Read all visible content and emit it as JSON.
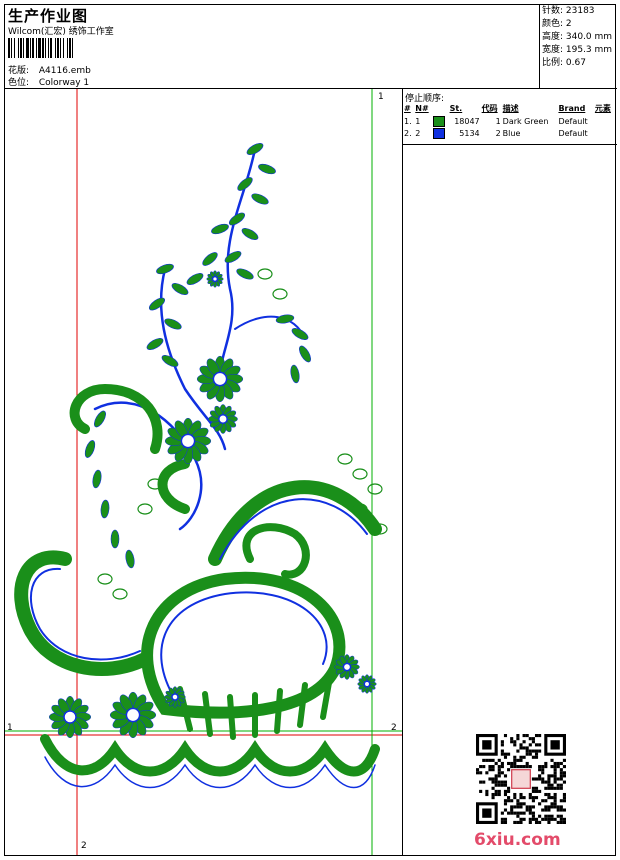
{
  "header": {
    "title": "生产作业图",
    "subtitle": "Wilcom(汇宏) 绣饰工作室",
    "design_label": "花版:",
    "design_value": "A4116.emb",
    "colorway_label": "色位:",
    "colorway_value": "Colorway 1"
  },
  "stats": {
    "stitches": "针数: 23183",
    "colors": "颜色: 2",
    "height": "高度: 340.0 mm",
    "width": "宽度: 195.3 mm",
    "scale": "比例: 0.67"
  },
  "stop_sequence": {
    "title": "停止顺序:",
    "columns": [
      "#",
      "N#",
      "St.",
      "代码",
      "描述",
      "Brand",
      "元素"
    ],
    "rows": [
      {
        "index": "1.",
        "n": "1",
        "swatch_color": "#1a8f1a",
        "stitches": "18047",
        "code": "1",
        "desc": "Dark Green",
        "brand": "Default",
        "element": ""
      },
      {
        "index": "2.",
        "n": "2",
        "swatch_color": "#1030e0",
        "stitches": "5134",
        "code": "2",
        "desc": "Blue",
        "brand": "Default",
        "element": ""
      }
    ]
  },
  "guides": {
    "vertical_top_label": "1",
    "vertical_bottom_label": "2",
    "horizontal_left_label": "1",
    "horizontal_right_label": "2"
  },
  "colors": {
    "green": "#1a8f1a",
    "blue": "#1030e0",
    "red_guide": "#e00000",
    "green_guide": "#00b000"
  },
  "watermark": "6xiu.com"
}
